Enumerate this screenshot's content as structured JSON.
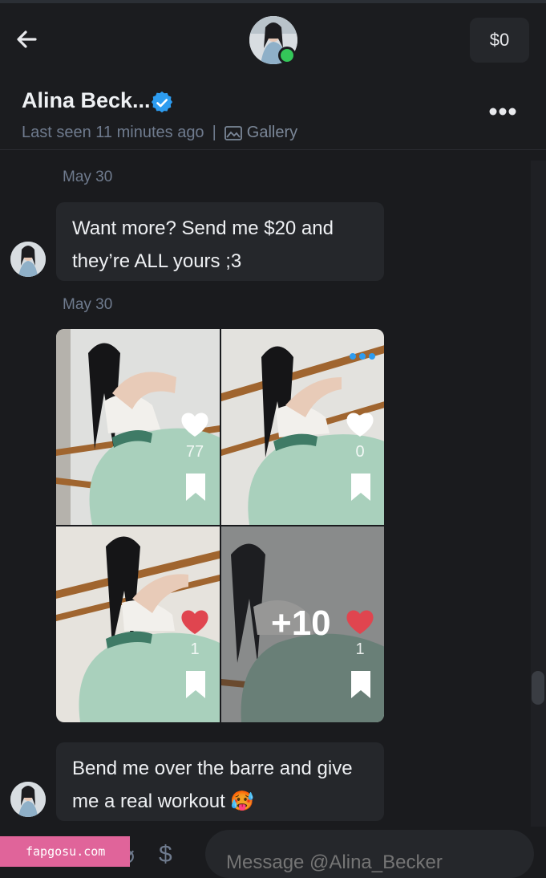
{
  "header": {
    "balance": "$0",
    "name": "Alina Beck...",
    "last_seen": "Last seen 11 minutes ago",
    "separator": "|",
    "gallery_label": "Gallery"
  },
  "messages": [
    {
      "date": "May 30",
      "text": "Want more? Send me $20 and they’re ALL yours ;3"
    },
    {
      "date": "May 30"
    }
  ],
  "media": [
    {
      "likes": "77",
      "liked": false
    },
    {
      "likes": "0",
      "liked": false
    },
    {
      "likes": "1",
      "liked": true
    },
    {
      "likes": "1",
      "liked": true,
      "overlay": "+10"
    }
  ],
  "last_message": {
    "text": "Bend me over the barre and give me a real workout 🥵"
  },
  "composer": {
    "placeholder": "Message @Alina_Becker"
  },
  "watermark": "fapgosu.com",
  "colors": {
    "background": "#1a1b1e",
    "bubble": "#25272b",
    "accent": "#2d9cf0",
    "heart_liked": "#e0454f"
  }
}
